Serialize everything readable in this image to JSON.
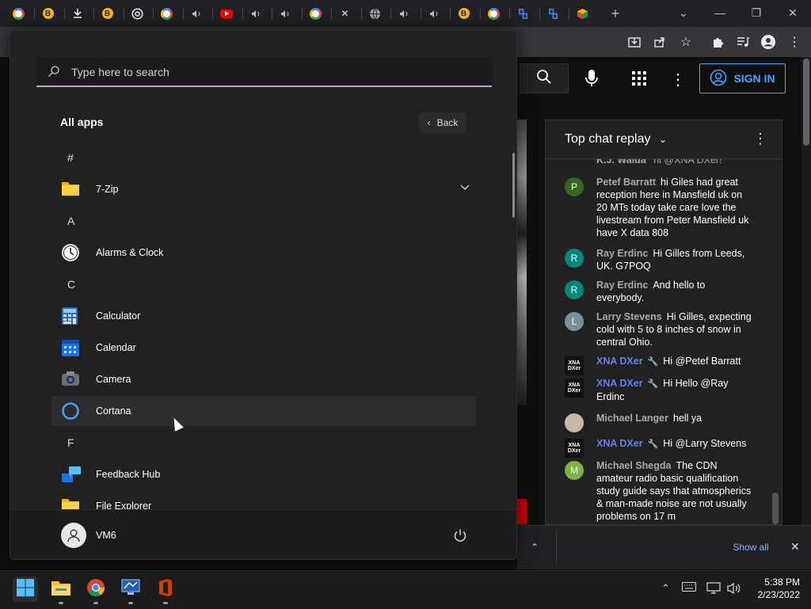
{
  "browser": {
    "tabs": [
      {
        "icon": "google-icon"
      },
      {
        "icon": "bing-b-icon",
        "text": "B"
      },
      {
        "icon": "download-icon"
      },
      {
        "icon": "bing-b-icon",
        "text": "B"
      },
      {
        "icon": "chrome-icon"
      },
      {
        "icon": "google-icon"
      },
      {
        "icon": "speaker-icon"
      },
      {
        "icon": "youtube-icon"
      },
      {
        "icon": "speaker-icon"
      },
      {
        "icon": "speaker-icon"
      },
      {
        "icon": "google-icon"
      },
      {
        "icon": "close-icon"
      },
      {
        "icon": "globe-icon"
      },
      {
        "icon": "speaker-icon"
      },
      {
        "icon": "speaker-icon"
      },
      {
        "icon": "bing-b-icon",
        "text": "B"
      },
      {
        "icon": "google-icon"
      },
      {
        "icon": "azure-icon"
      },
      {
        "icon": "azure-icon"
      },
      {
        "icon": "cube-icon"
      }
    ],
    "new_tab_glyph": "+",
    "window_controls": {
      "tab_search": "⌄",
      "minimize": "—",
      "restore": "❐",
      "close": "✕"
    }
  },
  "youtube": {
    "sign_in_label": "SIGN IN"
  },
  "chat": {
    "title": "Top chat replay",
    "messages": [
      {
        "author": "Petef Barratt",
        "avatar_letter": "P",
        "avatar_color": "#33691e",
        "text": "hi Giles had great reception here in Mansfield uk on 20 MTs today take care love the livestream from Peter Mansfield uk have X data 808"
      },
      {
        "author": "Ray Erdinc",
        "avatar_letter": "R",
        "avatar_color": "#00897b",
        "text": "Hi Gilles from Leeds, UK. G7POQ"
      },
      {
        "author": "Ray Erdinc",
        "avatar_letter": "R",
        "avatar_color": "#00897b",
        "text": "And hello to everybody."
      },
      {
        "author": "Larry Stevens",
        "avatar_letter": "L",
        "avatar_color": "#78909c",
        "text": "Hi Gilles, expecting cold with 5 to 8 inches of snow in central Ohio."
      },
      {
        "author": "XNA DXer",
        "owner": true,
        "avatar_text": "XNA DXer",
        "text": "Hi @Petef Barratt"
      },
      {
        "author": "XNA DXer",
        "owner": true,
        "avatar_text": "XNA DXer",
        "text": "Hi Hello @Ray Erdinc"
      },
      {
        "author": "Michael Langer",
        "avatar_photo": true,
        "avatar_color": "#c8b8a8",
        "text": "hell ya"
      },
      {
        "author": "XNA DXer",
        "owner": true,
        "avatar_text": "XNA DXer",
        "text": "Hi @Larry Stevens"
      },
      {
        "author": "Michael Shegda",
        "avatar_letter": "M",
        "avatar_color": "#7cb342",
        "text": "The CDN amateur radio basic qualification study guide says that atmospherics & man-made noise are not usually problems on 17 m"
      }
    ],
    "partial_top": {
      "author": "K.J. Walda",
      "text": "hi @XNA DXer!"
    }
  },
  "downloads": {
    "show_all_label": "Show all"
  },
  "start_menu": {
    "search_placeholder": "Type here to search",
    "all_apps_label": "All apps",
    "back_label": "Back",
    "sections": [
      {
        "letter": "#",
        "apps": [
          {
            "name": "7-Zip",
            "icon": "folder-icon",
            "expandable": true
          }
        ]
      },
      {
        "letter": "A",
        "apps": [
          {
            "name": "Alarms & Clock",
            "icon": "clock-icon"
          }
        ]
      },
      {
        "letter": "C",
        "apps": [
          {
            "name": "Calculator",
            "icon": "calculator-icon"
          },
          {
            "name": "Calendar",
            "icon": "calendar-icon"
          },
          {
            "name": "Camera",
            "icon": "camera-icon"
          },
          {
            "name": "Cortana",
            "icon": "cortana-icon",
            "hovered": true
          }
        ]
      },
      {
        "letter": "F",
        "apps": [
          {
            "name": "Feedback Hub",
            "icon": "feedback-hub-icon"
          },
          {
            "name": "File Explorer",
            "icon": "folder-icon"
          }
        ]
      }
    ],
    "user_name": "VM6"
  },
  "taskbar": {
    "apps": [
      "windows-start-icon",
      "file-explorer-icon",
      "chrome-icon",
      "remote-desktop-icon",
      "office-icon"
    ],
    "time": "5:38 PM",
    "date": "2/23/2022"
  },
  "colors": {
    "accent_blue": "#3ea6ff",
    "search_underline": "#c8a2c8",
    "owner_name": "#5e84f1"
  }
}
